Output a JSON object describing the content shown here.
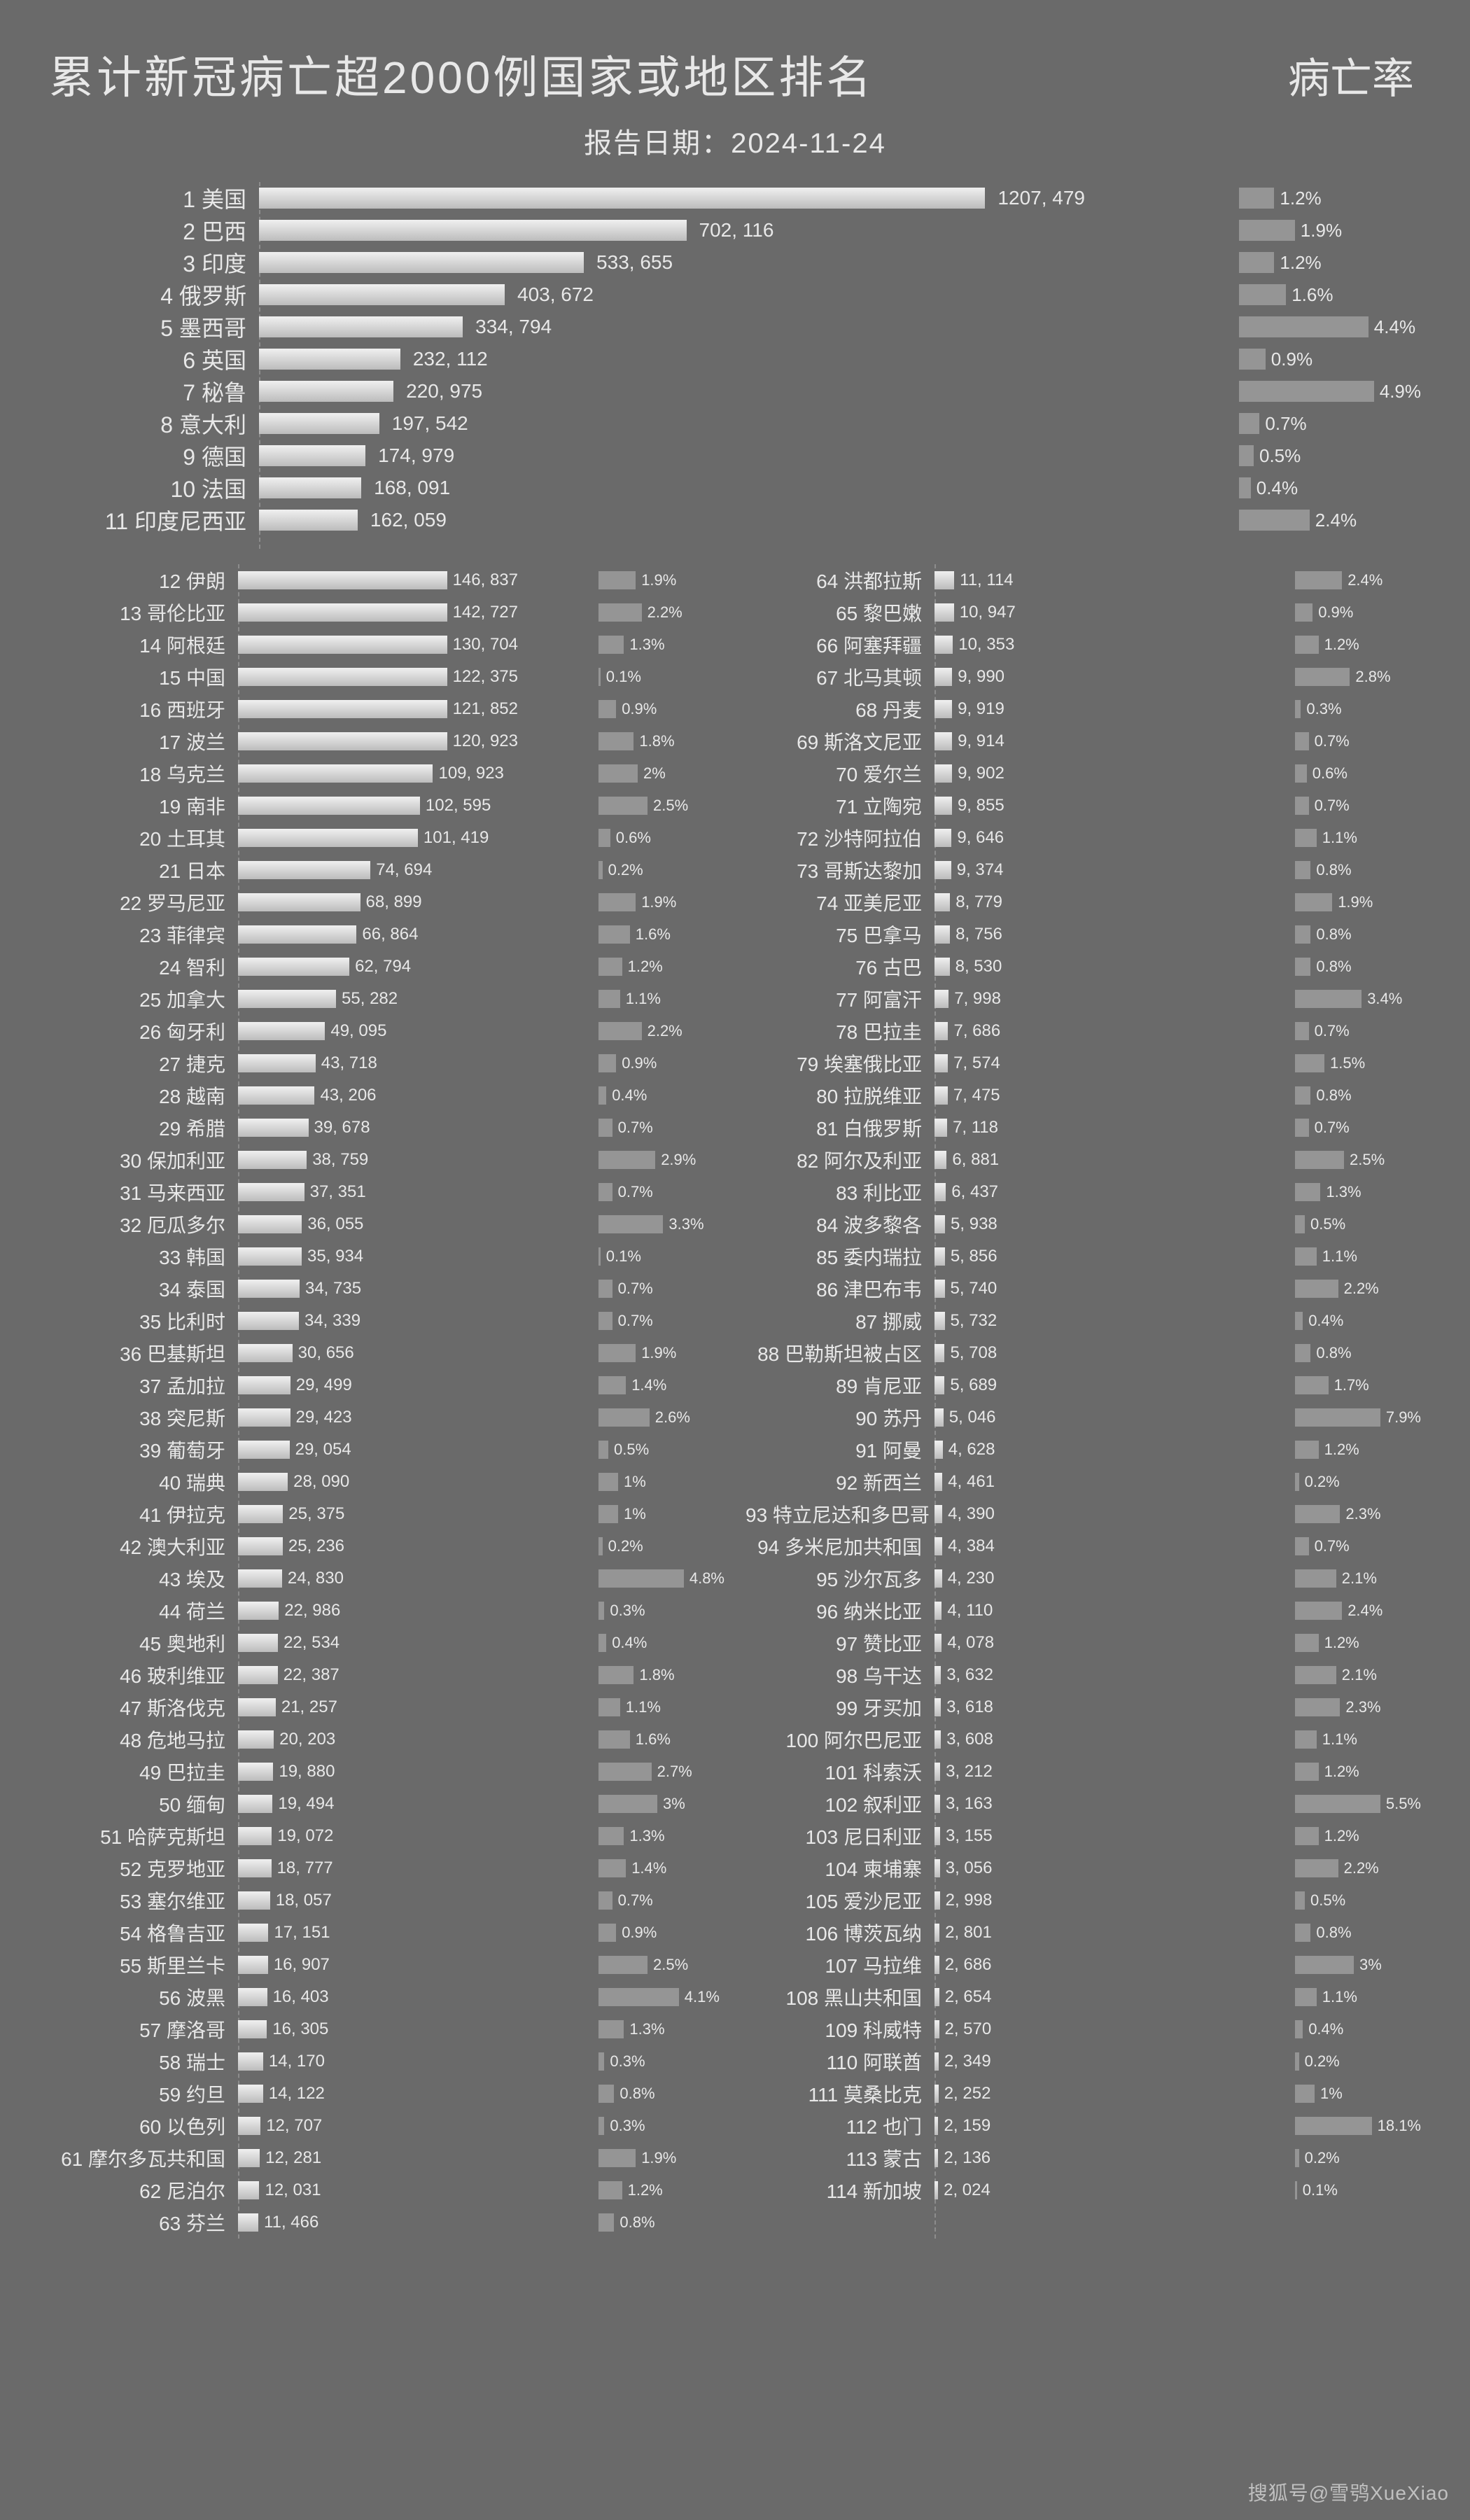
{
  "title": "累计新冠病亡超2000例国家或地区排名",
  "rateTitle": "病亡率",
  "subtitlePrefix": "报告日期：",
  "subtitleDate": "2024-11-24",
  "watermark": "搜狐号@雪鸮XueXiao",
  "chart_data": {
    "type": "bar",
    "title": "累计新冠病亡超2000例国家或地区排名",
    "secondary_metric": "病亡率",
    "report_date": "2024-11-24",
    "max_value": 1207479,
    "max_rate": 18.1,
    "columns": [
      "rank",
      "country",
      "deaths",
      "rate_pct"
    ],
    "rows": [
      [
        1,
        "美国",
        1207479,
        1.2
      ],
      [
        2,
        "巴西",
        702116,
        1.9
      ],
      [
        3,
        "印度",
        533655,
        1.2
      ],
      [
        4,
        "俄罗斯",
        403672,
        1.6
      ],
      [
        5,
        "墨西哥",
        334794,
        4.4
      ],
      [
        6,
        "英国",
        232112,
        0.9
      ],
      [
        7,
        "秘鲁",
        220975,
        4.9
      ],
      [
        8,
        "意大利",
        197542,
        0.7
      ],
      [
        9,
        "德国",
        174979,
        0.5
      ],
      [
        10,
        "法国",
        168091,
        0.4
      ],
      [
        11,
        "印度尼西亚",
        162059,
        2.4
      ],
      [
        12,
        "伊朗",
        146837,
        1.9
      ],
      [
        13,
        "哥伦比亚",
        142727,
        2.2
      ],
      [
        14,
        "阿根廷",
        130704,
        1.3
      ],
      [
        15,
        "中国",
        122375,
        0.1
      ],
      [
        16,
        "西班牙",
        121852,
        0.9
      ],
      [
        17,
        "波兰",
        120923,
        1.8
      ],
      [
        18,
        "乌克兰",
        109923,
        2.0
      ],
      [
        19,
        "南非",
        102595,
        2.5
      ],
      [
        20,
        "土耳其",
        101419,
        0.6
      ],
      [
        21,
        "日本",
        74694,
        0.2
      ],
      [
        22,
        "罗马尼亚",
        68899,
        1.9
      ],
      [
        23,
        "菲律宾",
        66864,
        1.6
      ],
      [
        24,
        "智利",
        62794,
        1.2
      ],
      [
        25,
        "加拿大",
        55282,
        1.1
      ],
      [
        26,
        "匈牙利",
        49095,
        2.2
      ],
      [
        27,
        "捷克",
        43718,
        0.9
      ],
      [
        28,
        "越南",
        43206,
        0.4
      ],
      [
        29,
        "希腊",
        39678,
        0.7
      ],
      [
        30,
        "保加利亚",
        38759,
        2.9
      ],
      [
        31,
        "马来西亚",
        37351,
        0.7
      ],
      [
        32,
        "厄瓜多尔",
        36055,
        3.3
      ],
      [
        33,
        "韩国",
        35934,
        0.1
      ],
      [
        34,
        "泰国",
        34735,
        0.7
      ],
      [
        35,
        "比利时",
        34339,
        0.7
      ],
      [
        36,
        "巴基斯坦",
        30656,
        1.9
      ],
      [
        37,
        "孟加拉",
        29499,
        1.4
      ],
      [
        38,
        "突尼斯",
        29423,
        2.6
      ],
      [
        39,
        "葡萄牙",
        29054,
        0.5
      ],
      [
        40,
        "瑞典",
        28090,
        1.0
      ],
      [
        41,
        "伊拉克",
        25375,
        1.0
      ],
      [
        42,
        "澳大利亚",
        25236,
        0.2
      ],
      [
        43,
        "埃及",
        24830,
        4.8
      ],
      [
        44,
        "荷兰",
        22986,
        0.3
      ],
      [
        45,
        "奥地利",
        22534,
        0.4
      ],
      [
        46,
        "玻利维亚",
        22387,
        1.8
      ],
      [
        47,
        "斯洛伐克",
        21257,
        1.1
      ],
      [
        48,
        "危地马拉",
        20203,
        1.6
      ],
      [
        49,
        "巴拉圭",
        19880,
        2.7
      ],
      [
        50,
        "缅甸",
        19494,
        3.0
      ],
      [
        51,
        "哈萨克斯坦",
        19072,
        1.3
      ],
      [
        52,
        "克罗地亚",
        18777,
        1.4
      ],
      [
        53,
        "塞尔维亚",
        18057,
        0.7
      ],
      [
        54,
        "格鲁吉亚",
        17151,
        0.9
      ],
      [
        55,
        "斯里兰卡",
        16907,
        2.5
      ],
      [
        56,
        "波黑",
        16403,
        4.1
      ],
      [
        57,
        "摩洛哥",
        16305,
        1.3
      ],
      [
        58,
        "瑞士",
        14170,
        0.3
      ],
      [
        59,
        "约旦",
        14122,
        0.8
      ],
      [
        60,
        "以色列",
        12707,
        0.3
      ],
      [
        61,
        "摩尔多瓦共和国",
        12281,
        1.9
      ],
      [
        62,
        "尼泊尔",
        12031,
        1.2
      ],
      [
        63,
        "芬兰",
        11466,
        0.8
      ],
      [
        64,
        "洪都拉斯",
        11114,
        2.4
      ],
      [
        65,
        "黎巴嫩",
        10947,
        0.9
      ],
      [
        66,
        "阿塞拜疆",
        10353,
        1.2
      ],
      [
        67,
        "北马其顿",
        9990,
        2.8
      ],
      [
        68,
        "丹麦",
        9919,
        0.3
      ],
      [
        69,
        "斯洛文尼亚",
        9914,
        0.7
      ],
      [
        70,
        "爱尔兰",
        9902,
        0.6
      ],
      [
        71,
        "立陶宛",
        9855,
        0.7
      ],
      [
        72,
        "沙特阿拉伯",
        9646,
        1.1
      ],
      [
        73,
        "哥斯达黎加",
        9374,
        0.8
      ],
      [
        74,
        "亚美尼亚",
        8779,
        1.9
      ],
      [
        75,
        "巴拿马",
        8756,
        0.8
      ],
      [
        76,
        "古巴",
        8530,
        0.8
      ],
      [
        77,
        "阿富汗",
        7998,
        3.4
      ],
      [
        78,
        "巴拉圭",
        7686,
        0.7
      ],
      [
        79,
        "埃塞俄比亚",
        7574,
        1.5
      ],
      [
        80,
        "拉脱维亚",
        7475,
        0.8
      ],
      [
        81,
        "白俄罗斯",
        7118,
        0.7
      ],
      [
        82,
        "阿尔及利亚",
        6881,
        2.5
      ],
      [
        83,
        "利比亚",
        6437,
        1.3
      ],
      [
        84,
        "波多黎各",
        5938,
        0.5
      ],
      [
        85,
        "委内瑞拉",
        5856,
        1.1
      ],
      [
        86,
        "津巴布韦",
        5740,
        2.2
      ],
      [
        87,
        "挪威",
        5732,
        0.4
      ],
      [
        88,
        "巴勒斯坦被占区",
        5708,
        0.8
      ],
      [
        89,
        "肯尼亚",
        5689,
        1.7
      ],
      [
        90,
        "苏丹",
        5046,
        7.9
      ],
      [
        91,
        "阿曼",
        4628,
        1.2
      ],
      [
        92,
        "新西兰",
        4461,
        0.2
      ],
      [
        93,
        "特立尼达和多巴哥",
        4390,
        2.3
      ],
      [
        94,
        "多米尼加共和国",
        4384,
        0.7
      ],
      [
        95,
        "沙尔瓦多",
        4230,
        2.1
      ],
      [
        96,
        "纳米比亚",
        4110,
        2.4
      ],
      [
        97,
        "赞比亚",
        4078,
        1.2
      ],
      [
        98,
        "乌干达",
        3632,
        2.1
      ],
      [
        99,
        "牙买加",
        3618,
        2.3
      ],
      [
        100,
        "阿尔巴尼亚",
        3608,
        1.1
      ],
      [
        101,
        "科索沃",
        3212,
        1.2
      ],
      [
        102,
        "叙利亚",
        3163,
        5.5
      ],
      [
        103,
        "尼日利亚",
        3155,
        1.2
      ],
      [
        104,
        "柬埔寨",
        3056,
        2.2
      ],
      [
        105,
        "爱沙尼亚",
        2998,
        0.5
      ],
      [
        106,
        "博茨瓦纳",
        2801,
        0.8
      ],
      [
        107,
        "马拉维",
        2686,
        3.0
      ],
      [
        108,
        "黑山共和国",
        2654,
        1.1
      ],
      [
        109,
        "科威特",
        2570,
        0.4
      ],
      [
        110,
        "阿联酋",
        2349,
        0.2
      ],
      [
        111,
        "莫桑比克",
        2252,
        1.0
      ],
      [
        112,
        "也门",
        2159,
        18.1
      ],
      [
        113,
        "蒙古",
        2136,
        0.2
      ],
      [
        114,
        "新加坡",
        2024,
        0.1
      ]
    ]
  }
}
